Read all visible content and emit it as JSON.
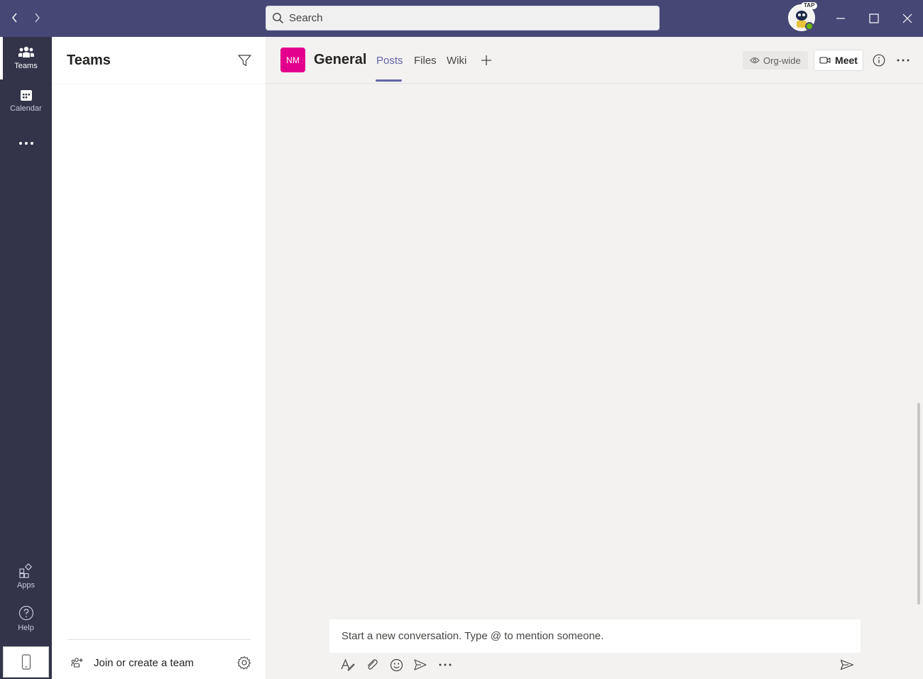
{
  "titlebar": {
    "search_placeholder": "Search",
    "avatar_badge": "TAP",
    "accent_color": "#464775"
  },
  "rail": {
    "items": [
      {
        "label": "Teams",
        "icon": "teams-icon"
      },
      {
        "label": "Calendar",
        "icon": "calendar-icon"
      },
      {
        "label": "Apps",
        "icon": "apps-icon"
      },
      {
        "label": "Help",
        "icon": "help-icon"
      }
    ]
  },
  "teams_pane": {
    "title": "Teams",
    "join_label": "Join or create a team"
  },
  "channel": {
    "team_initials": "NM",
    "team_color": "#e3008c",
    "name": "General",
    "tabs": [
      {
        "label": "Posts"
      },
      {
        "label": "Files"
      },
      {
        "label": "Wiki"
      }
    ],
    "active_tab": "Posts",
    "orgwide_label": "Org-wide",
    "meet_label": "Meet"
  },
  "compose": {
    "placeholder": "Start a new conversation. Type @ to mention someone."
  }
}
